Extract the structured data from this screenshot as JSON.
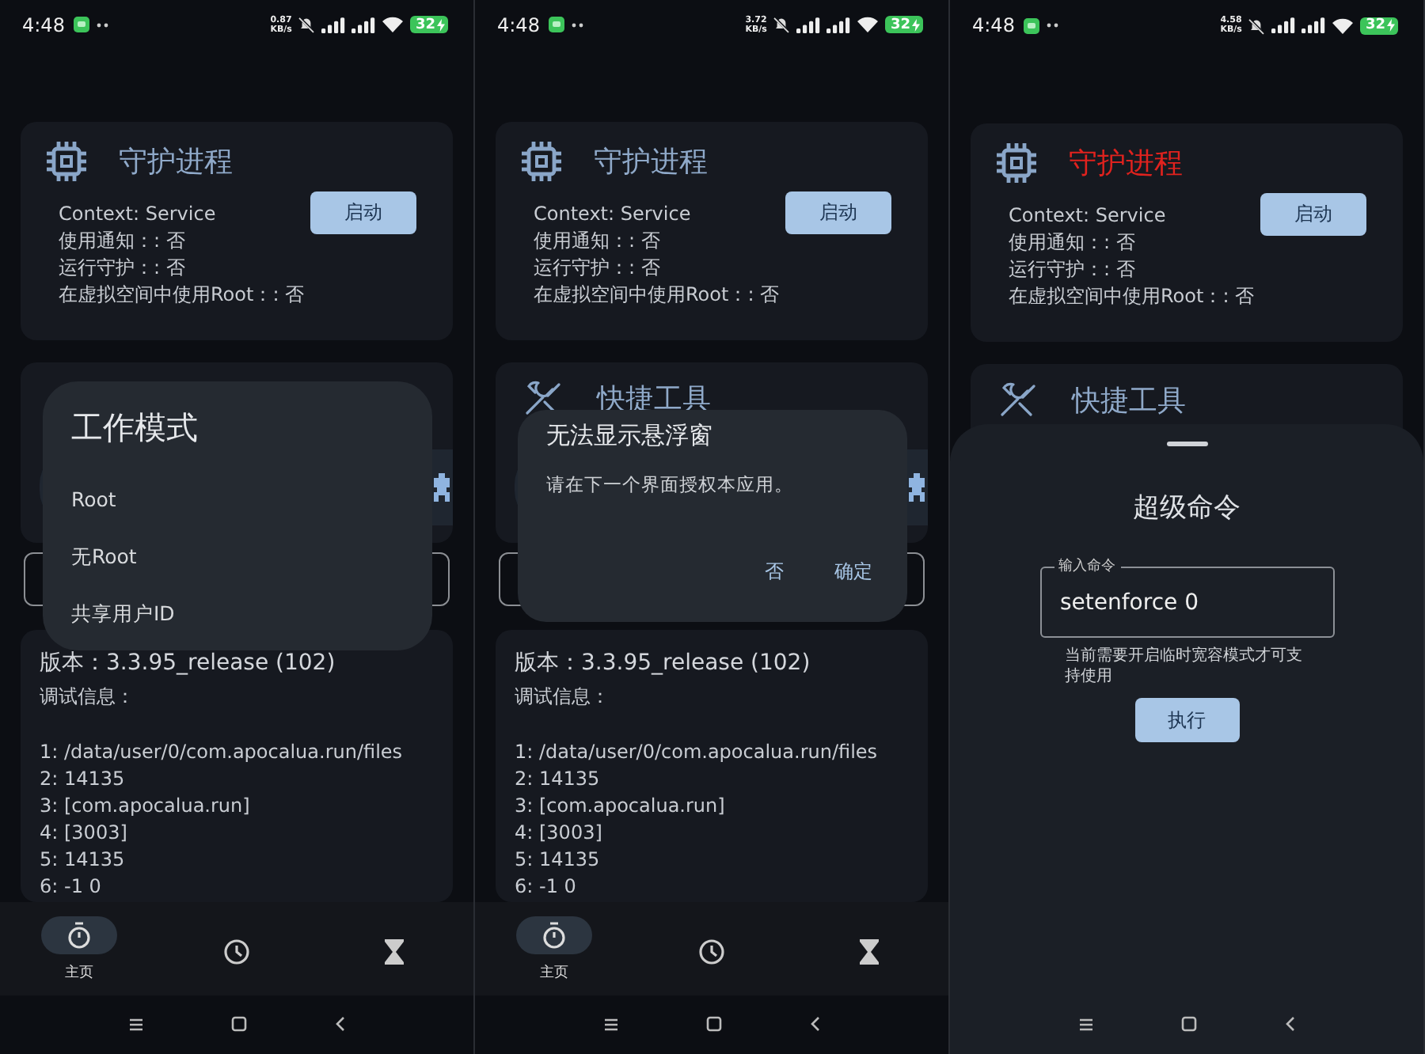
{
  "panels": [
    {
      "status": {
        "time": "4:48",
        "speed_value": "0.87",
        "speed_unit": "KB/s",
        "battery": "32"
      },
      "daemon_card": {
        "title": "守护进程",
        "title_alert": false,
        "lines": [
          "Context: Service",
          "使用通知：: 否",
          "运行守护：: 否",
          "在虚拟空间中使用Root：: 否"
        ],
        "button": "启动"
      },
      "version_card": {
        "title": "版本：3.3.95_release (102)",
        "debug_label": "调试信息：",
        "lines": [
          "1: /data/user/0/com.apocalua.run/files",
          "2: 14135",
          "3: [com.apocalua.run]",
          "4: [3003]",
          "5: 14135",
          "6: -1 0"
        ]
      },
      "bottom_nav": [
        {
          "kind": "stopwatch",
          "label": "主页",
          "selected": true
        },
        {
          "kind": "clock",
          "selected": false
        },
        {
          "kind": "hourglass",
          "selected": false
        }
      ],
      "overlay": {
        "kind": "choice_dialog",
        "title": "工作模式",
        "options": [
          "Root",
          "无Root",
          "共享用户ID"
        ]
      }
    },
    {
      "status": {
        "time": "4:48",
        "speed_value": "3.72",
        "speed_unit": "KB/s",
        "battery": "32"
      },
      "daemon_card": {
        "title": "守护进程",
        "title_alert": false,
        "lines": [
          "Context: Service",
          "使用通知：: 否",
          "运行守护：: 否",
          "在虚拟空间中使用Root：: 否"
        ],
        "button": "启动"
      },
      "tools_card": {
        "title": "快捷工具"
      },
      "version_card": {
        "title": "版本：3.3.95_release (102)",
        "debug_label": "调试信息：",
        "lines": [
          "1: /data/user/0/com.apocalua.run/files",
          "2: 14135",
          "3: [com.apocalua.run]",
          "4: [3003]",
          "5: 14135",
          "6: -1 0"
        ]
      },
      "bottom_nav": [
        {
          "kind": "stopwatch",
          "label": "主页",
          "selected": true
        },
        {
          "kind": "clock",
          "selected": false
        },
        {
          "kind": "hourglass",
          "selected": false
        }
      ],
      "overlay": {
        "kind": "confirm_dialog",
        "title": "无法显示悬浮窗",
        "message": "请在下一个界面授权本应用。",
        "buttons": [
          "否",
          "确定"
        ]
      }
    },
    {
      "status": {
        "time": "4:48",
        "speed_value": "4.58",
        "speed_unit": "KB/s",
        "battery": "32"
      },
      "daemon_card": {
        "title": "守护进程",
        "title_alert": true,
        "lines": [
          "Context: Service",
          "使用通知：: 否",
          "运行守护：: 否",
          "在虚拟空间中使用Root：: 否"
        ],
        "button": "启动"
      },
      "tools_card": {
        "title": "快捷工具"
      },
      "overlay": {
        "kind": "bottom_sheet",
        "title": "超级命令",
        "field_label": "输入命令",
        "field_value": "setenforce 0",
        "helper": "当前需要开启临时宽容模式才可支持使用",
        "button": "执行"
      }
    }
  ]
}
